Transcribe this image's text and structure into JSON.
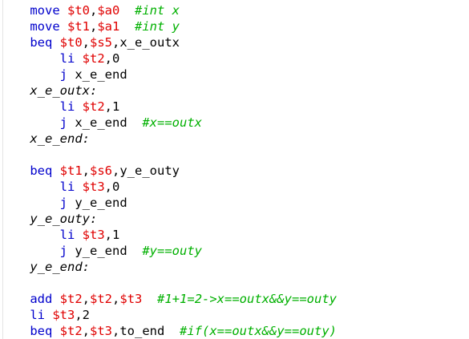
{
  "editor": {
    "colors": {
      "keyword": "#0000cc",
      "register": "#e00000",
      "comment": "#00b000",
      "text": "#000000",
      "background": "#ffffff"
    },
    "lines": [
      [
        {
          "t": "    ",
          "c": "txt"
        },
        {
          "t": "move",
          "c": "kw"
        },
        {
          "t": " ",
          "c": "txt"
        },
        {
          "t": "$t0",
          "c": "reg"
        },
        {
          "t": ",",
          "c": "txt"
        },
        {
          "t": "$a0",
          "c": "reg"
        },
        {
          "t": "  ",
          "c": "txt"
        },
        {
          "t": "#int x",
          "c": "cm"
        }
      ],
      [
        {
          "t": "    ",
          "c": "txt"
        },
        {
          "t": "move",
          "c": "kw"
        },
        {
          "t": " ",
          "c": "txt"
        },
        {
          "t": "$t1",
          "c": "reg"
        },
        {
          "t": ",",
          "c": "txt"
        },
        {
          "t": "$a1",
          "c": "reg"
        },
        {
          "t": "  ",
          "c": "txt"
        },
        {
          "t": "#int y",
          "c": "cm"
        }
      ],
      [
        {
          "t": "    ",
          "c": "txt"
        },
        {
          "t": "beq",
          "c": "kw"
        },
        {
          "t": " ",
          "c": "txt"
        },
        {
          "t": "$t0",
          "c": "reg"
        },
        {
          "t": ",",
          "c": "txt"
        },
        {
          "t": "$s5",
          "c": "reg"
        },
        {
          "t": ",x_e_outx",
          "c": "txt"
        }
      ],
      [
        {
          "t": "        ",
          "c": "txt"
        },
        {
          "t": "li",
          "c": "kw"
        },
        {
          "t": " ",
          "c": "txt"
        },
        {
          "t": "$t2",
          "c": "reg"
        },
        {
          "t": ",0",
          "c": "txt"
        }
      ],
      [
        {
          "t": "        ",
          "c": "txt"
        },
        {
          "t": "j",
          "c": "kw"
        },
        {
          "t": " x_e_end",
          "c": "txt"
        }
      ],
      [
        {
          "t": "    ",
          "c": "txt"
        },
        {
          "t": "x_e_outx:",
          "c": "lbl"
        }
      ],
      [
        {
          "t": "        ",
          "c": "txt"
        },
        {
          "t": "li",
          "c": "kw"
        },
        {
          "t": " ",
          "c": "txt"
        },
        {
          "t": "$t2",
          "c": "reg"
        },
        {
          "t": ",1",
          "c": "txt"
        }
      ],
      [
        {
          "t": "        ",
          "c": "txt"
        },
        {
          "t": "j",
          "c": "kw"
        },
        {
          "t": " x_e_end  ",
          "c": "txt"
        },
        {
          "t": "#x==outx",
          "c": "cm"
        }
      ],
      [
        {
          "t": "    ",
          "c": "txt"
        },
        {
          "t": "x_e_end:",
          "c": "lbl"
        }
      ],
      [],
      [
        {
          "t": "    ",
          "c": "txt"
        },
        {
          "t": "beq",
          "c": "kw"
        },
        {
          "t": " ",
          "c": "txt"
        },
        {
          "t": "$t1",
          "c": "reg"
        },
        {
          "t": ",",
          "c": "txt"
        },
        {
          "t": "$s6",
          "c": "reg"
        },
        {
          "t": ",y_e_outy",
          "c": "txt"
        }
      ],
      [
        {
          "t": "        ",
          "c": "txt"
        },
        {
          "t": "li",
          "c": "kw"
        },
        {
          "t": " ",
          "c": "txt"
        },
        {
          "t": "$t3",
          "c": "reg"
        },
        {
          "t": ",0",
          "c": "txt"
        }
      ],
      [
        {
          "t": "        ",
          "c": "txt"
        },
        {
          "t": "j",
          "c": "kw"
        },
        {
          "t": " y_e_end",
          "c": "txt"
        }
      ],
      [
        {
          "t": "    ",
          "c": "txt"
        },
        {
          "t": "y_e_outy:",
          "c": "lbl"
        }
      ],
      [
        {
          "t": "        ",
          "c": "txt"
        },
        {
          "t": "li",
          "c": "kw"
        },
        {
          "t": " ",
          "c": "txt"
        },
        {
          "t": "$t3",
          "c": "reg"
        },
        {
          "t": ",1",
          "c": "txt"
        }
      ],
      [
        {
          "t": "        ",
          "c": "txt"
        },
        {
          "t": "j",
          "c": "kw"
        },
        {
          "t": " y_e_end  ",
          "c": "txt"
        },
        {
          "t": "#y==outy",
          "c": "cm"
        }
      ],
      [
        {
          "t": "    ",
          "c": "txt"
        },
        {
          "t": "y_e_end:",
          "c": "lbl"
        }
      ],
      [],
      [
        {
          "t": "    ",
          "c": "txt"
        },
        {
          "t": "add",
          "c": "kw"
        },
        {
          "t": " ",
          "c": "txt"
        },
        {
          "t": "$t2",
          "c": "reg"
        },
        {
          "t": ",",
          "c": "txt"
        },
        {
          "t": "$t2",
          "c": "reg"
        },
        {
          "t": ",",
          "c": "txt"
        },
        {
          "t": "$t3",
          "c": "reg"
        },
        {
          "t": "  ",
          "c": "txt"
        },
        {
          "t": "#1+1=2->x==outx&&y==outy",
          "c": "cm"
        }
      ],
      [
        {
          "t": "    ",
          "c": "txt"
        },
        {
          "t": "li",
          "c": "kw"
        },
        {
          "t": " ",
          "c": "txt"
        },
        {
          "t": "$t3",
          "c": "reg"
        },
        {
          "t": ",2",
          "c": "txt"
        }
      ],
      [
        {
          "t": "    ",
          "c": "txt"
        },
        {
          "t": "beq",
          "c": "kw"
        },
        {
          "t": " ",
          "c": "txt"
        },
        {
          "t": "$t2",
          "c": "reg"
        },
        {
          "t": ",",
          "c": "txt"
        },
        {
          "t": "$t3",
          "c": "reg"
        },
        {
          "t": ",to_end  ",
          "c": "txt"
        },
        {
          "t": "#if(x==outx&&y==outy)",
          "c": "cm"
        }
      ]
    ]
  }
}
